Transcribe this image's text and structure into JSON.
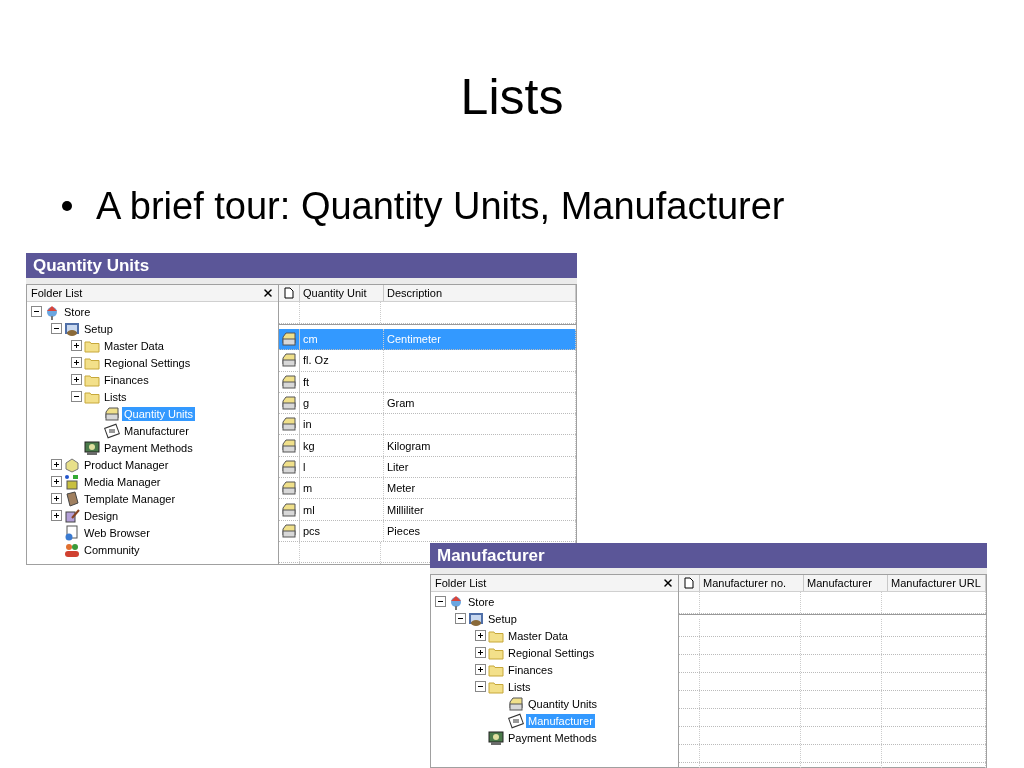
{
  "slide": {
    "title": "Lists",
    "bullets": [
      "A brief tour: Quantity Units, Manufacturer"
    ]
  },
  "windows": [
    {
      "title": "Quantity Units",
      "folder_list": {
        "title": "Folder List",
        "tree": [
          {
            "label": "Store",
            "kind": "store",
            "expanded": true,
            "selected": false,
            "children": [
              {
                "label": "Setup",
                "kind": "setup",
                "expanded": true,
                "selected": false,
                "children": [
                  {
                    "label": "Master Data",
                    "kind": "folder",
                    "expanded": false,
                    "selected": false
                  },
                  {
                    "label": "Regional Settings",
                    "kind": "folder",
                    "expanded": false,
                    "selected": false
                  },
                  {
                    "label": "Finances",
                    "kind": "folder",
                    "expanded": false,
                    "selected": false
                  },
                  {
                    "label": "Lists",
                    "kind": "folder",
                    "expanded": true,
                    "selected": false,
                    "children": [
                      {
                        "label": "Quantity Units",
                        "kind": "drawer",
                        "selected": true
                      },
                      {
                        "label": "Manufacturer",
                        "kind": "card",
                        "selected": false
                      }
                    ]
                  },
                  {
                    "label": "Payment Methods",
                    "kind": "payment",
                    "selected": false
                  }
                ]
              },
              {
                "label": "Product Manager",
                "kind": "product",
                "expanded": false,
                "selected": false
              },
              {
                "label": "Media Manager",
                "kind": "media",
                "expanded": false,
                "selected": false
              },
              {
                "label": "Template Manager",
                "kind": "template",
                "expanded": false,
                "selected": false
              },
              {
                "label": "Design",
                "kind": "design",
                "expanded": false,
                "selected": false
              },
              {
                "label": "Web Browser",
                "kind": "web",
                "selected": false
              },
              {
                "label": "Community",
                "kind": "community",
                "selected": false
              }
            ]
          }
        ]
      },
      "table": {
        "columns": [
          "Quantity Unit",
          "Description"
        ],
        "rows": [
          {
            "cells": [
              "cm",
              "Centimeter"
            ],
            "selected": true
          },
          {
            "cells": [
              "fl. Oz",
              ""
            ],
            "selected": false
          },
          {
            "cells": [
              "ft",
              ""
            ],
            "selected": false
          },
          {
            "cells": [
              "g",
              "Gram"
            ],
            "selected": false
          },
          {
            "cells": [
              "in",
              ""
            ],
            "selected": false
          },
          {
            "cells": [
              "kg",
              "Kilogram"
            ],
            "selected": false
          },
          {
            "cells": [
              "l",
              "Liter"
            ],
            "selected": false
          },
          {
            "cells": [
              "m",
              "Meter"
            ],
            "selected": false
          },
          {
            "cells": [
              "ml",
              "Milliliter"
            ],
            "selected": false
          },
          {
            "cells": [
              "pcs",
              "Pieces"
            ],
            "selected": false
          }
        ]
      }
    },
    {
      "title": "Manufacturer",
      "folder_list": {
        "title": "Folder List",
        "tree": [
          {
            "label": "Store",
            "kind": "store",
            "expanded": true,
            "selected": false,
            "children": [
              {
                "label": "Setup",
                "kind": "setup",
                "expanded": true,
                "selected": false,
                "children": [
                  {
                    "label": "Master Data",
                    "kind": "folder",
                    "expanded": false,
                    "selected": false
                  },
                  {
                    "label": "Regional Settings",
                    "kind": "folder",
                    "expanded": false,
                    "selected": false
                  },
                  {
                    "label": "Finances",
                    "kind": "folder",
                    "expanded": false,
                    "selected": false
                  },
                  {
                    "label": "Lists",
                    "kind": "folder",
                    "expanded": true,
                    "selected": false,
                    "children": [
                      {
                        "label": "Quantity Units",
                        "kind": "drawer",
                        "selected": false
                      },
                      {
                        "label": "Manufacturer",
                        "kind": "card",
                        "selected": true
                      }
                    ]
                  },
                  {
                    "label": "Payment Methods",
                    "kind": "payment",
                    "selected": false
                  }
                ]
              }
            ]
          }
        ]
      },
      "table": {
        "columns": [
          "Manufacturer no.",
          "Manufacturer",
          "Manufacturer URL"
        ]
      }
    }
  ]
}
